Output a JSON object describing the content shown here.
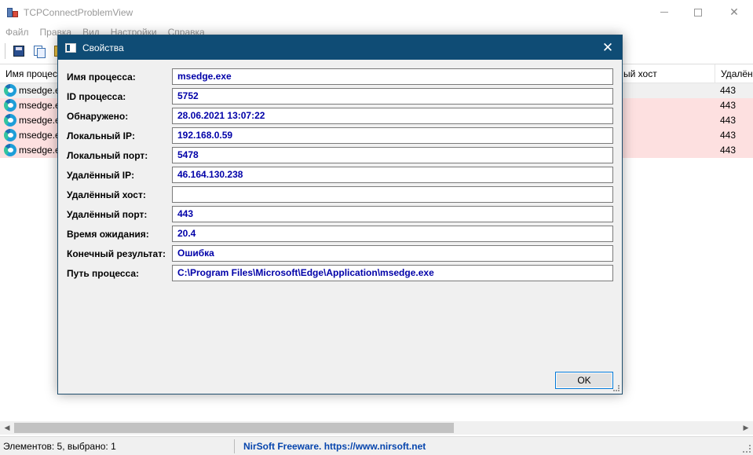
{
  "window": {
    "title": "TCPConnectProblemView",
    "controls": {
      "minimize": "—",
      "maximize": "☐",
      "close": "✕"
    }
  },
  "menu": {
    "items": [
      {
        "label": "Файл"
      },
      {
        "label": "Правка"
      },
      {
        "label": "Вид"
      },
      {
        "label": "Настройки"
      },
      {
        "label": "Справка"
      }
    ]
  },
  "toolbar": {
    "icons": [
      "save-icon",
      "copy-icon",
      "properties-icon"
    ]
  },
  "list": {
    "columns": [
      {
        "label": "Имя процесса"
      },
      {
        "label": "ый хост"
      },
      {
        "label": "Удалён"
      }
    ],
    "rows": [
      {
        "name": "msedge.e",
        "port": "443",
        "status": "normal"
      },
      {
        "name": "msedge.e",
        "port": "443",
        "status": "err"
      },
      {
        "name": "msedge.e",
        "port": "443",
        "status": "err"
      },
      {
        "name": "msedge.e",
        "port": "443",
        "status": "err"
      },
      {
        "name": "msedge.e",
        "port": "443",
        "status": "err"
      }
    ]
  },
  "status": {
    "count": "Элементов: 5, выбрано: 1",
    "credit": "NirSoft Freeware. https://www.nirsoft.net"
  },
  "dialog": {
    "title": "Свойства",
    "close": "✕",
    "fields": [
      {
        "label": "Имя процесса:",
        "value": "msedge.exe"
      },
      {
        "label": "ID процесса:",
        "value": "5752"
      },
      {
        "label": "Обнаружено:",
        "value": "28.06.2021 13:07:22"
      },
      {
        "label": "Локальный IP:",
        "value": "192.168.0.59"
      },
      {
        "label": "Локальный порт:",
        "value": "5478"
      },
      {
        "label": "Удалённый IP:",
        "value": "46.164.130.238"
      },
      {
        "label": "Удалённый хост:",
        "value": ""
      },
      {
        "label": "Удалённый порт:",
        "value": "443"
      },
      {
        "label": "Время ожидания:",
        "value": "20.4"
      },
      {
        "label": "Конечный результат:",
        "value": "Ошибка"
      },
      {
        "label": "Путь процесса:",
        "value": "C:\\Program Files\\Microsoft\\Edge\\Application\\msedge.exe"
      }
    ],
    "ok_label": "OK"
  },
  "colors": {
    "dialog_title_bg": "#0f4c75",
    "value_text": "#0000a8",
    "error_row": "#fde0e0",
    "link": "#0645ad"
  }
}
